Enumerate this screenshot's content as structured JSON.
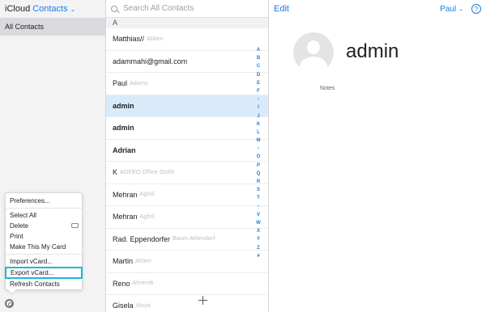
{
  "sidebar": {
    "brand": "iCloud",
    "app": "Contacts",
    "group": "All Contacts"
  },
  "menu": {
    "items": [
      "Preferences...",
      "Select All",
      "Delete",
      "Print",
      "Make This My Card",
      "Import vCard...",
      "Export vCard...",
      "Refresh Contacts"
    ]
  },
  "search": {
    "placeholder": "Search All Contacts"
  },
  "list": {
    "section": "A",
    "contacts": [
      {
        "first": "Matthias//",
        "rest": "Abken",
        "bold": false,
        "selected": false
      },
      {
        "first": "adammahi@gmail.com",
        "rest": "",
        "bold": false,
        "selected": false
      },
      {
        "first": "Paul",
        "rest": "Adams",
        "bold": false,
        "selected": false
      },
      {
        "first": "admin",
        "rest": "",
        "bold": true,
        "selected": true
      },
      {
        "first": "admin",
        "rest": "",
        "bold": true,
        "selected": false
      },
      {
        "first": "Adrian",
        "rest": "",
        "bold": true,
        "selected": false
      },
      {
        "first": "K",
        "rest": "AOFEO Office Outfit",
        "bold": false,
        "selected": false
      },
      {
        "first": "Mehran",
        "rest": "Aghili",
        "bold": false,
        "selected": false
      },
      {
        "first": "Mehran",
        "rest": "Aghili",
        "bold": false,
        "selected": false
      },
      {
        "first": "Rad. Eppendorfer",
        "rest": "Baum Ahlendorf",
        "bold": false,
        "selected": false
      },
      {
        "first": "Martin",
        "rest": "Ahlert",
        "bold": false,
        "selected": false
      },
      {
        "first": "Reno",
        "rest": "Ahrendt",
        "bold": false,
        "selected": false
      },
      {
        "first": "Gisela",
        "rest": "Ahuis",
        "bold": false,
        "selected": false
      }
    ],
    "index": [
      "A",
      "B",
      "C",
      "D",
      "E",
      "F",
      "•",
      "I",
      "J",
      "K",
      "L",
      "M",
      "•",
      "O",
      "P",
      "Q",
      "R",
      "S",
      "T",
      "•",
      "V",
      "W",
      "X",
      "Y",
      "Z",
      "#"
    ]
  },
  "detail": {
    "edit": "Edit",
    "user": "Paul",
    "help": "?",
    "name": "admin",
    "notes_label": "Notes"
  }
}
